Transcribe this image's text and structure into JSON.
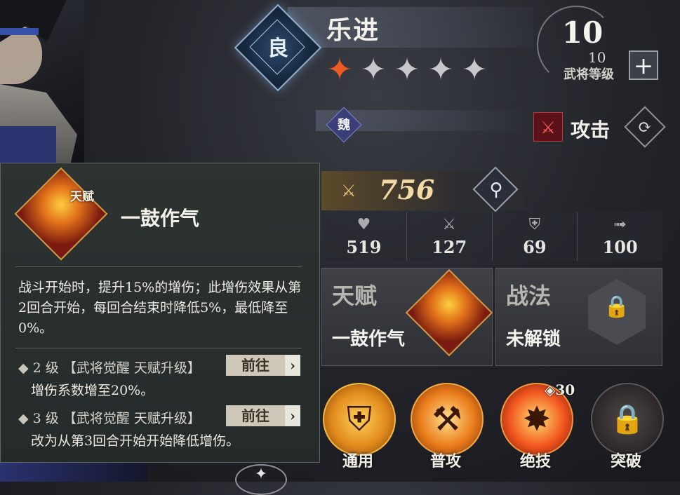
{
  "hero": {
    "rank": "良",
    "name": "乐进",
    "stars_total": 5,
    "stars_filled": 1,
    "faction": "魏",
    "role_label": "攻击",
    "level": "10",
    "level_max": "10",
    "level_label": "武将等级",
    "plus_label": "+",
    "power": "756"
  },
  "stats": [
    {
      "icon": "heart-icon",
      "glyph": "♥",
      "value": "519"
    },
    {
      "icon": "swords-icon",
      "glyph": "⚔",
      "value": "127"
    },
    {
      "icon": "shield-icon",
      "glyph": "⛨",
      "value": "69"
    },
    {
      "icon": "boot-icon",
      "glyph": "➟",
      "value": "100"
    }
  ],
  "cards": {
    "talent_title": "天赋",
    "talent_name": "一鼓作气",
    "tactic_title": "战法",
    "tactic_status": "未解锁"
  },
  "skills": [
    {
      "label": "通用",
      "icon": "shield-skill-icon",
      "glyph": "⛨"
    },
    {
      "label": "普攻",
      "icon": "hammer-skill-icon",
      "glyph": "⚒"
    },
    {
      "label": "绝技",
      "icon": "explosion-skill-icon",
      "glyph": "✸",
      "cost": "30"
    },
    {
      "label": "突破",
      "icon": "lock-icon",
      "glyph": "🔒"
    }
  ],
  "popup": {
    "tag": "天赋",
    "name": "一鼓作气",
    "description": "战斗开始时，提升15%的增伤；此增伤效果从第2回合开始，每回合结束时降低5%，最低降至0%。",
    "levels": [
      {
        "level": "2 级",
        "source": "【武将觉醒 天赋升级】",
        "button": "前往",
        "effect": "增伤系数增至20%。"
      },
      {
        "level": "3 级",
        "source": "【武将觉醒 天赋升级】",
        "button": "前往",
        "effect": "改为从第3回合开始开始降低增伤。"
      }
    ]
  },
  "colors": {
    "star_on": "#ee5a26",
    "star_off": "#c7c8cc",
    "power_text": "#f3d9a3",
    "attack_red": "#b33a3a"
  }
}
